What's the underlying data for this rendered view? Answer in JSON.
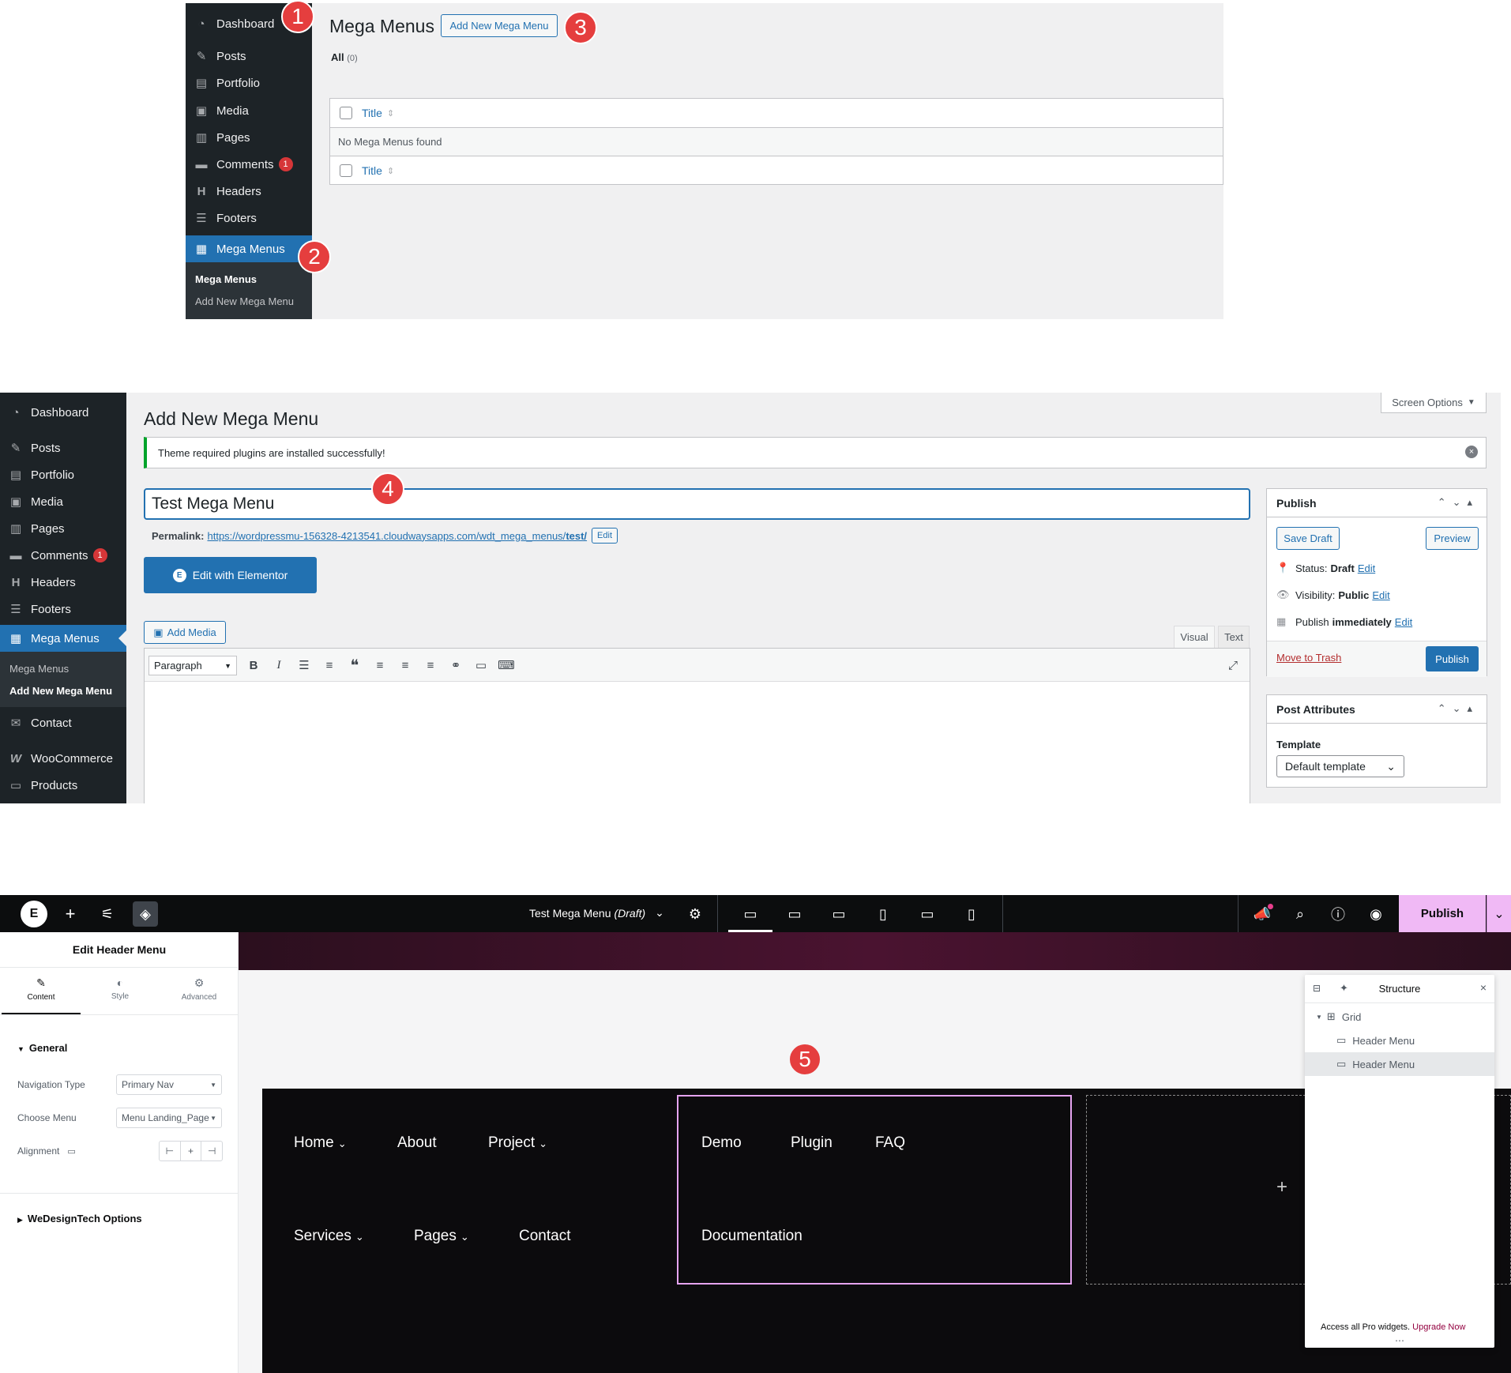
{
  "panel1": {
    "sidebar": {
      "items": [
        {
          "icon": "dashboard-icon",
          "label": "Dashboard"
        },
        {
          "icon": "pin-icon",
          "label": "Posts"
        },
        {
          "icon": "portfolio-icon",
          "label": "Portfolio"
        },
        {
          "icon": "media-icon",
          "label": "Media"
        },
        {
          "icon": "pages-icon",
          "label": "Pages"
        },
        {
          "icon": "comments-icon",
          "label": "Comments",
          "badge": "1"
        },
        {
          "icon": "h-icon",
          "label": "Headers"
        },
        {
          "icon": "footer-icon",
          "label": "Footers"
        },
        {
          "icon": "table-icon",
          "label": "Mega Menus",
          "active": true
        }
      ],
      "submenu": [
        "Mega Menus",
        "Add New Mega Menu"
      ]
    },
    "page_title": "Mega Menus",
    "add_new_label": "Add New Mega Menu",
    "filter_all": "All",
    "filter_count": "(0)",
    "table": {
      "column_title": "Title",
      "empty_message": "No Mega Menus found"
    },
    "callouts": [
      "1",
      "2",
      "3"
    ]
  },
  "panel2": {
    "sidebar": {
      "items": [
        {
          "icon": "dashboard-icon",
          "label": "Dashboard"
        },
        {
          "icon": "pin-icon",
          "label": "Posts"
        },
        {
          "icon": "portfolio-icon",
          "label": "Portfolio"
        },
        {
          "icon": "media-icon",
          "label": "Media"
        },
        {
          "icon": "pages-icon",
          "label": "Pages"
        },
        {
          "icon": "comments-icon",
          "label": "Comments",
          "badge": "1"
        },
        {
          "icon": "h-icon",
          "label": "Headers"
        },
        {
          "icon": "footer-icon",
          "label": "Footers"
        },
        {
          "icon": "table-icon",
          "label": "Mega Menus",
          "active": true
        }
      ],
      "submenu": [
        "Mega Menus",
        "Add New Mega Menu"
      ],
      "after": [
        {
          "icon": "mail-icon",
          "label": "Contact"
        },
        {
          "icon": "woo-icon",
          "label": "WooCommerce"
        },
        {
          "icon": "products-icon",
          "label": "Products"
        }
      ]
    },
    "screen_options": "Screen Options",
    "page_title": "Add New Mega Menu",
    "notice": "Theme required plugins are installed successfully!",
    "title_value": "Test Mega Menu",
    "permalink_label": "Permalink:",
    "permalink_base": "https://wordpressmu-156328-4213541.cloudwaysapps.com/wdt_mega_menus/",
    "permalink_slug": "test/",
    "permalink_edit": "Edit",
    "elementor_button": "Edit with Elementor",
    "add_media": "Add Media",
    "tab_visual": "Visual",
    "tab_text": "Text",
    "format_select": "Paragraph",
    "publish_box": {
      "title": "Publish",
      "save_draft": "Save Draft",
      "preview": "Preview",
      "status_label": "Status:",
      "status_value": "Draft",
      "visibility_label": "Visibility:",
      "visibility_value": "Public",
      "publish_label": "Publish",
      "publish_value": "immediately",
      "edit": "Edit",
      "trash": "Move to Trash",
      "publish_button": "Publish"
    },
    "attributes_box": {
      "title": "Post Attributes",
      "template_label": "Template",
      "template_value": "Default template"
    },
    "callout": "4"
  },
  "panel3": {
    "doc_title": "Test Mega Menu",
    "doc_status": "(Draft)",
    "publish": "Publish",
    "panel_title": "Edit Header Menu",
    "tabs": [
      "Content",
      "Style",
      "Advanced"
    ],
    "section_general": "General",
    "nav_type_label": "Navigation Type",
    "nav_type_value": "Primary Nav",
    "choose_menu_label": "Choose Menu",
    "choose_menu_value": "Menu Landing_Page",
    "alignment_label": "Alignment",
    "section_options": "WeDesignTech Options",
    "nav_left": [
      {
        "label": "Home",
        "dropdown": true
      },
      {
        "label": "About",
        "dropdown": false
      },
      {
        "label": "Project",
        "dropdown": true
      },
      {
        "label": "Services",
        "dropdown": true
      },
      {
        "label": "Pages",
        "dropdown": true
      },
      {
        "label": "Contact",
        "dropdown": false
      }
    ],
    "nav_mid": [
      "Demo",
      "Plugin",
      "FAQ",
      "Documentation"
    ],
    "add_symbol": "+",
    "structure": {
      "title": "Structure",
      "grid": "Grid",
      "items": [
        "Header Menu",
        "Header Menu"
      ],
      "footer_text": "Access all Pro widgets.",
      "footer_link": "Upgrade Now"
    },
    "callout": "5"
  },
  "colors": {
    "wp_sidebar": "#1d2327",
    "wp_blue": "#2271b1",
    "callout_red": "#e53e3e",
    "elementor_publish": "#f0b9f5",
    "mega_border": "#e6a4f0"
  }
}
